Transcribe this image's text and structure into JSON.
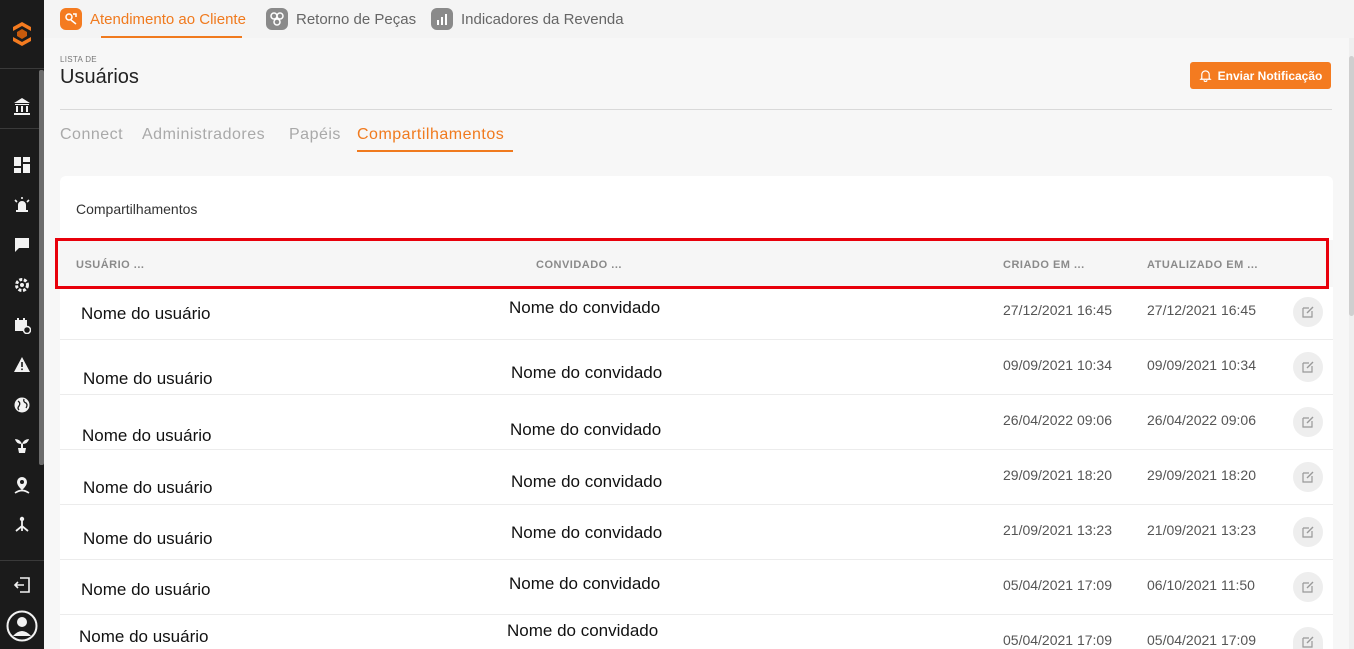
{
  "app_tabs": [
    {
      "label": "Atendimento ao Cliente",
      "active": true,
      "icon": "customer-service-icon"
    },
    {
      "label": "Retorno de Peças",
      "active": false,
      "icon": "parts-return-icon"
    },
    {
      "label": "Indicadores da Revenda",
      "active": false,
      "icon": "bar-chart-icon"
    }
  ],
  "sidebar": {
    "icons": [
      "dealer-icon",
      "dashboard-icon",
      "alarm-icon",
      "chat-icon",
      "settings-icon",
      "calendar-icon",
      "warning-icon",
      "globe-icon",
      "plant-icon",
      "location-user-icon",
      "network-icon",
      "logout-icon",
      "user-avatar-icon"
    ]
  },
  "header": {
    "crumb": "LISTA DE",
    "title": "Usuários",
    "notify_label": "Enviar Notificação"
  },
  "sub_tabs": [
    {
      "label": "Connect",
      "active": false
    },
    {
      "label": "Administradores",
      "active": false
    },
    {
      "label": "Papéis",
      "active": false
    },
    {
      "label": "Compartilhamentos",
      "active": true
    }
  ],
  "card": {
    "title": "Compartilhamentos",
    "columns": [
      "USUÁRIO ...",
      "CONVIDADO ...",
      "CRIADO EM ...",
      "ATUALIZADO EM ..."
    ],
    "rows": [
      {
        "user": "Nome do usuário",
        "guest": "Nome do convidado",
        "created": "27/12/2021 16:45",
        "updated": "27/12/2021 16:45"
      },
      {
        "user": "Nome do usuário",
        "guest": "Nome do convidado",
        "created": "09/09/2021 10:34",
        "updated": "09/09/2021 10:34"
      },
      {
        "user": "Nome do usuário",
        "guest": "Nome do convidado",
        "created": "26/04/2022 09:06",
        "updated": "26/04/2022 09:06"
      },
      {
        "user": "Nome do usuário",
        "guest": "Nome do convidado",
        "created": "29/09/2021 18:20",
        "updated": "29/09/2021 18:20"
      },
      {
        "user": "Nome do usuário",
        "guest": "Nome do convidado",
        "created": "21/09/2021 13:23",
        "updated": "21/09/2021 13:23"
      },
      {
        "user": "Nome do usuário",
        "guest": "Nome do convidado",
        "created": "05/04/2021 17:09",
        "updated": "06/10/2021 11:50"
      },
      {
        "user": "Nome do usuário",
        "guest": "Nome do convidado",
        "created": "05/04/2021 17:09",
        "updated": "05/04/2021 17:09"
      }
    ]
  },
  "colors": {
    "accent": "#f07a1e",
    "highlight": "#e8000b",
    "sidebar": "#1b1b1b"
  }
}
